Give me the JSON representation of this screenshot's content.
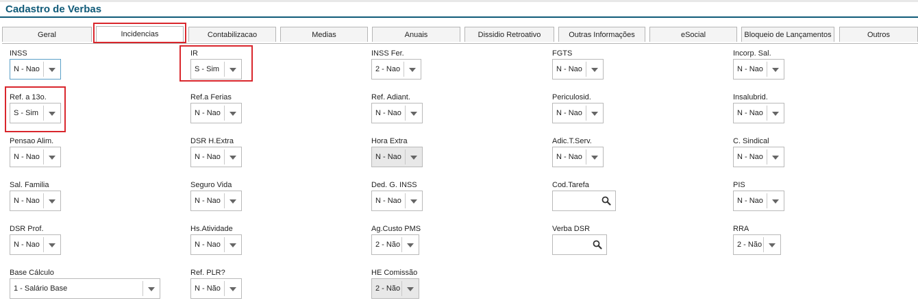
{
  "page": {
    "title": "Cadastro de Verbas"
  },
  "tabs": [
    "Geral",
    "Incidencias",
    "Contabilizacao",
    "Medias",
    "Anuais",
    "Dissidio Retroativo",
    "Outras Informações",
    "eSocial",
    "Bloqueio de Lançamentos",
    "Outros"
  ],
  "active_tab": "Incidencias",
  "fields": {
    "inss": {
      "label": "INSS",
      "value": "N - Nao"
    },
    "ir": {
      "label": "IR",
      "value": "S - Sim"
    },
    "inss_fer": {
      "label": "INSS Fer.",
      "value": "2 - Nao"
    },
    "fgts": {
      "label": "FGTS",
      "value": "N - Nao"
    },
    "incorp_sal": {
      "label": "Incorp. Sal.",
      "value": "N - Nao"
    },
    "ref_13": {
      "label": "Ref. a 13o.",
      "value": "S - Sim"
    },
    "ref_ferias": {
      "label": "Ref.a Ferias",
      "value": "N - Nao"
    },
    "ref_adiant": {
      "label": "Ref. Adiant.",
      "value": "N - Nao"
    },
    "periculosid": {
      "label": "Periculosid.",
      "value": "N - Nao"
    },
    "insalubrid": {
      "label": "Insalubrid.",
      "value": "N - Nao"
    },
    "pensao_alim": {
      "label": "Pensao Alim.",
      "value": "N - Nao"
    },
    "dsr_hextra": {
      "label": "DSR H.Extra",
      "value": "N - Nao"
    },
    "hora_extra": {
      "label": "Hora Extra",
      "value": "N - Nao"
    },
    "adic_tserv": {
      "label": "Adic.T.Serv.",
      "value": "N - Nao"
    },
    "c_sindical": {
      "label": "C. Sindical",
      "value": "N - Nao"
    },
    "sal_familia": {
      "label": "Sal. Familia",
      "value": "N - Nao"
    },
    "seguro_vida": {
      "label": "Seguro Vida",
      "value": "N - Nao"
    },
    "ded_g_inss": {
      "label": "Ded. G. INSS",
      "value": "N - Nao"
    },
    "cod_tarefa": {
      "label": "Cod.Tarefa",
      "value": ""
    },
    "pis": {
      "label": "PIS",
      "value": "N - Nao"
    },
    "dsr_prof": {
      "label": "DSR Prof.",
      "value": "N - Nao"
    },
    "hs_atividade": {
      "label": "Hs.Atividade",
      "value": "N - Nao"
    },
    "ag_custo_pms": {
      "label": "Ag.Custo PMS",
      "value": "2 - Não"
    },
    "verba_dsr": {
      "label": "Verba DSR",
      "value": ""
    },
    "rra": {
      "label": "RRA",
      "value": "2 - Não"
    },
    "base_calculo": {
      "label": "Base Cálculo",
      "value": "1 - Salário Base"
    },
    "ref_plr": {
      "label": "Ref. PLR?",
      "value": "N - Não"
    },
    "he_comissao": {
      "label": "HE Comissão",
      "value": "2 - Não"
    }
  },
  "colors": {
    "title": "#0f5a78",
    "highlight": "#d9262c",
    "disabled": "#e8e8e8"
  },
  "icons": {
    "dropdown": "chevron-down-icon",
    "lookup": "search-icon"
  }
}
